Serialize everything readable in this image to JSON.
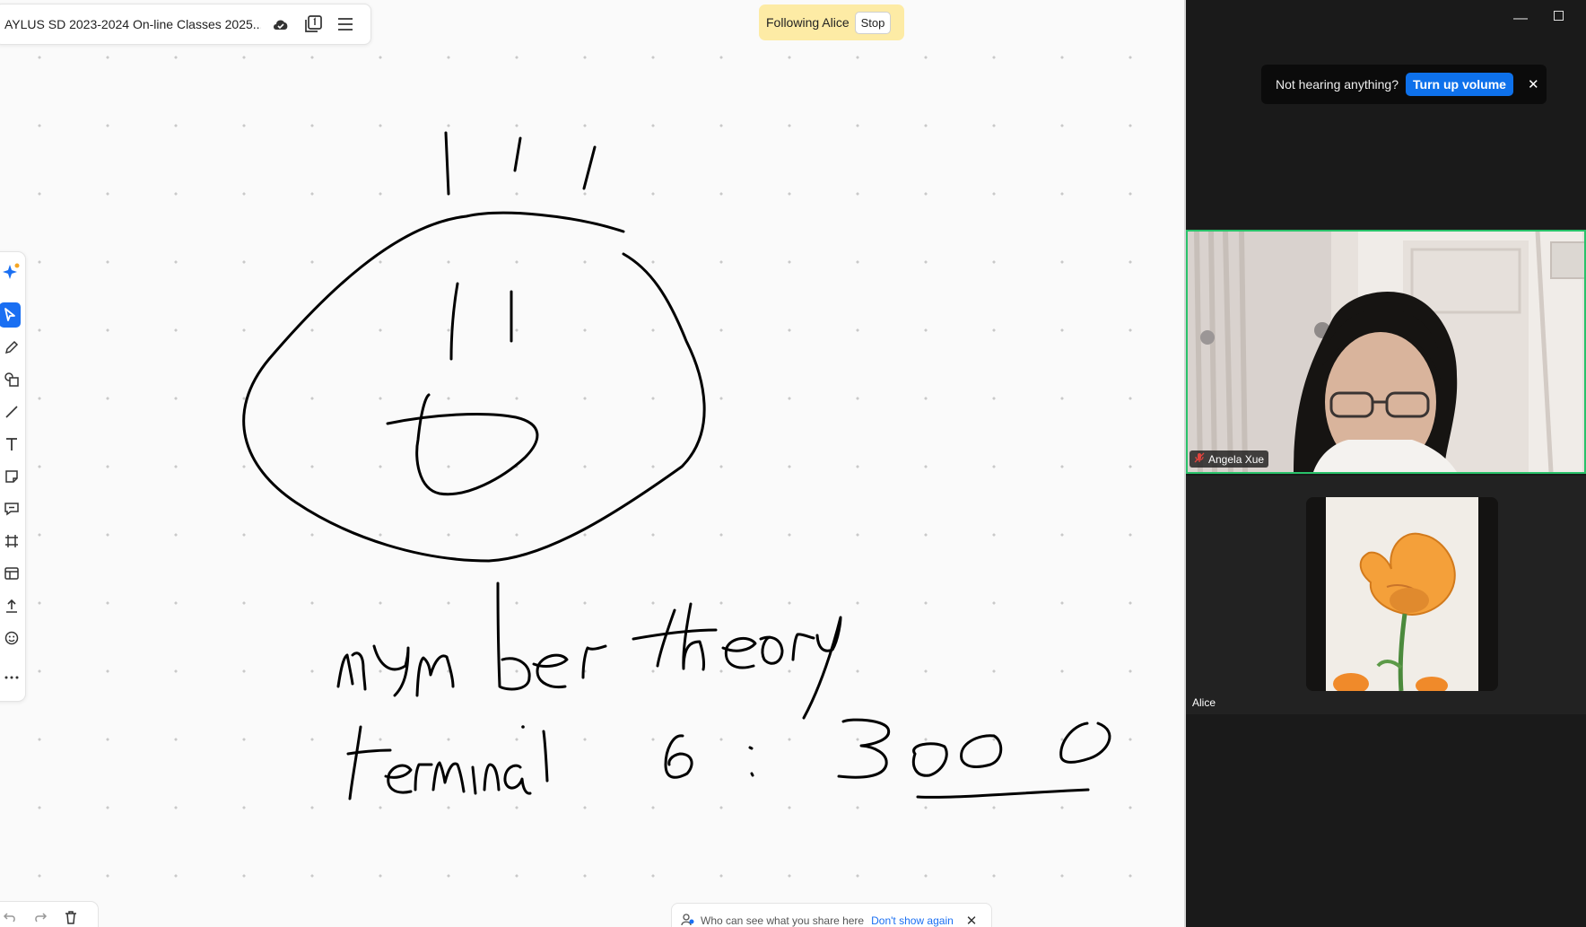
{
  "board": {
    "title": "AYLUS SD 2023-2024 On-line Classes 2025...",
    "following_text": "Following Alice",
    "stop_label": "Stop",
    "share_notice": "Who can see what you share here",
    "dont_show_again": "Don't show again"
  },
  "zoom": {
    "volume_prompt": "Not hearing anything?",
    "turn_up_volume": "Turn up volume",
    "participants": [
      {
        "name": "Angela Xue",
        "muted": true,
        "speaking": true
      },
      {
        "name": "Alice",
        "muted": false,
        "speaking": false
      }
    ]
  },
  "toolbar": {
    "tools": [
      "ai-assistant-icon",
      "select-icon",
      "pen-icon",
      "shapes-icon",
      "line-icon",
      "text-icon",
      "sticky-note-icon",
      "comment-icon",
      "frame-icon",
      "table-icon",
      "upload-icon",
      "emoji-icon",
      "more-icon"
    ],
    "active_tool": "select-icon"
  },
  "colors": {
    "accent_blue": "#1a6ff2",
    "following_bg": "#fdeba5",
    "speaker_border": "#29c26a",
    "zoom_bg": "#1a1a1a"
  }
}
